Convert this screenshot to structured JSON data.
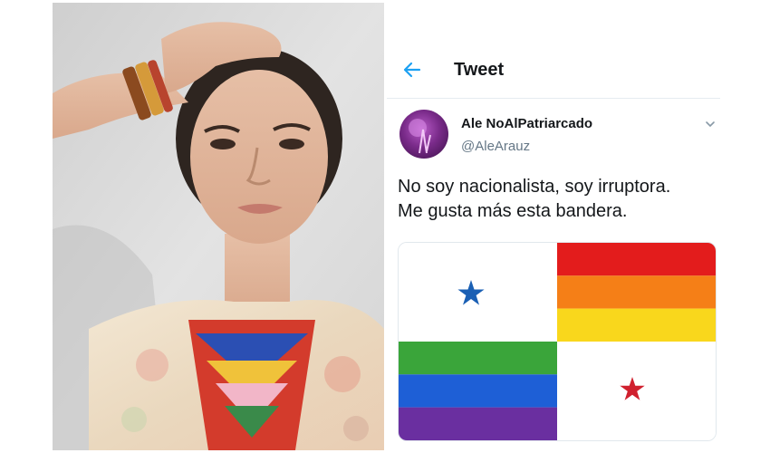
{
  "header": {
    "title": "Tweet",
    "back_icon": "arrow-left-icon"
  },
  "tweet": {
    "author_name": "Ale NoAlPatriarcado",
    "author_handle": "@AleArauz",
    "text_line1": "No soy nacionalista, soy irruptora.",
    "text_line2": "Me gusta más esta bandera.",
    "menu_icon": "chevron-down-icon"
  },
  "colors": {
    "accent": "#1da1f2",
    "star_blue": "#1a5fb4",
    "star_red": "#d0202e",
    "rainbow": [
      "#e31c1c",
      "#f57f17",
      "#f9d71c",
      "#3aa53a",
      "#1e5fd6",
      "#6a2fa0"
    ]
  }
}
